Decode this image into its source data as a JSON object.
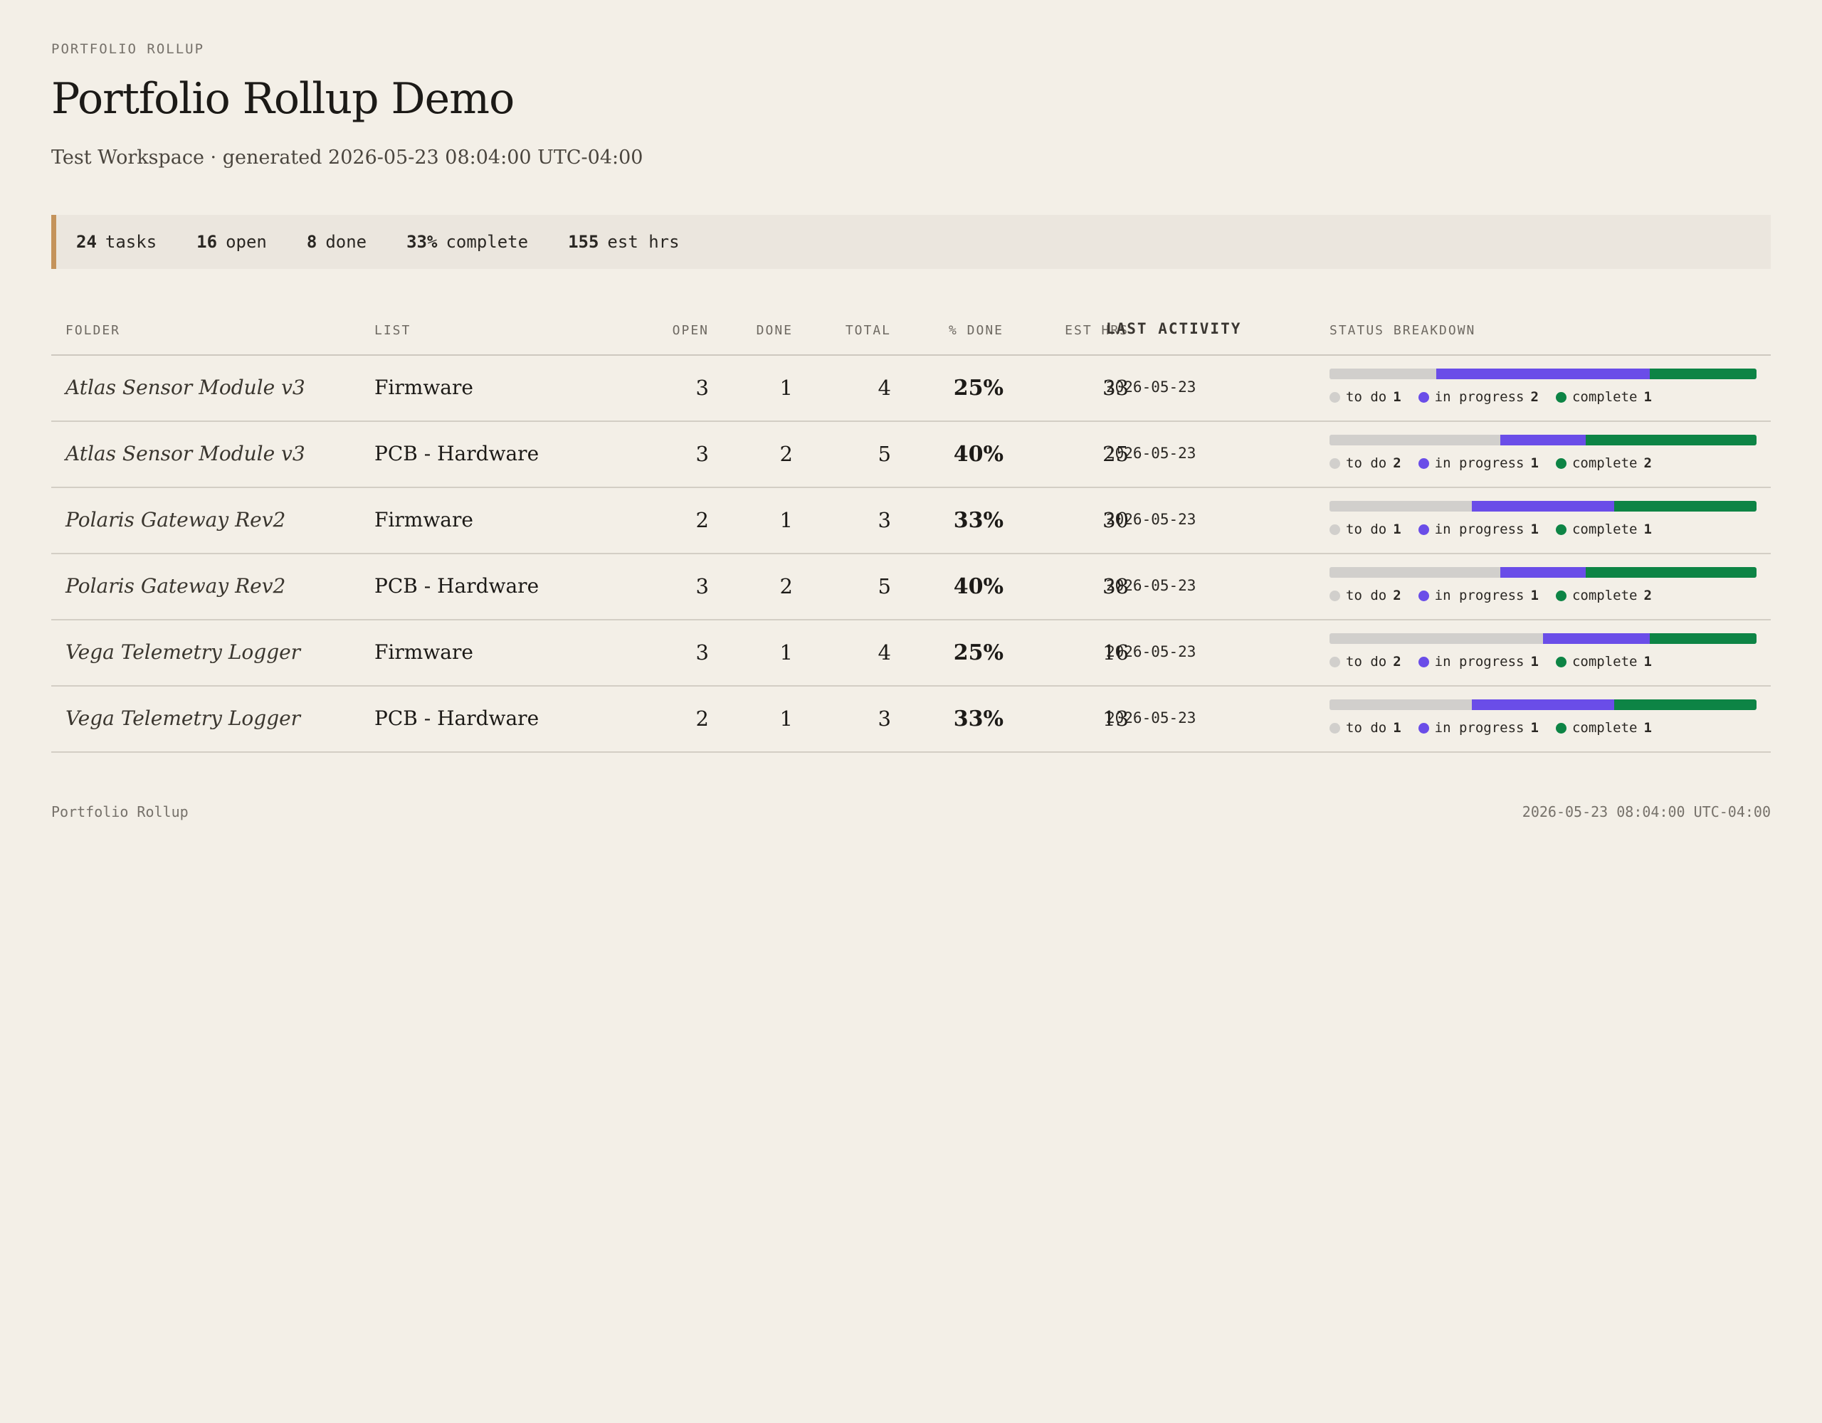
{
  "header": {
    "eyebrow": "PORTFOLIO ROLLUP",
    "title": "Portfolio Rollup Demo",
    "subtitle": "Test Workspace · generated 2026-05-23 08:04:00 UTC-04:00"
  },
  "summary": [
    {
      "value": "24",
      "label": "tasks"
    },
    {
      "value": "16",
      "label": "open"
    },
    {
      "value": "8",
      "label": "done"
    },
    {
      "value": "33%",
      "label": "complete"
    },
    {
      "value": "155",
      "label": "est hrs"
    }
  ],
  "columns": {
    "folder": "FOLDER",
    "list": "LIST",
    "open": "OPEN",
    "done": "DONE",
    "total": "TOTAL",
    "pct_done": "% DONE",
    "est_hrs": "EST HRS",
    "last_activity": "LAST ACTIVITY",
    "status_breakdown": "STATUS BREAKDOWN"
  },
  "legend_labels": {
    "todo": "to do",
    "in_progress": "in progress",
    "complete": "complete"
  },
  "colors": {
    "todo": "#d1cfcc",
    "in_progress": "#6a4de8",
    "complete": "#0d8445",
    "accent": "#c4935b"
  },
  "rows": [
    {
      "folder": "Atlas Sensor Module v3",
      "list": "Firmware",
      "open": "3",
      "done": "1",
      "total": "4",
      "pct_done": "25%",
      "est_hrs": "33",
      "last_activity": "2026-05-23",
      "todo": 1,
      "in_progress": 2,
      "complete": 1
    },
    {
      "folder": "Atlas Sensor Module v3",
      "list": "PCB - Hardware",
      "open": "3",
      "done": "2",
      "total": "5",
      "pct_done": "40%",
      "est_hrs": "25",
      "last_activity": "2026-05-23",
      "todo": 2,
      "in_progress": 1,
      "complete": 2
    },
    {
      "folder": "Polaris Gateway Rev2",
      "list": "Firmware",
      "open": "2",
      "done": "1",
      "total": "3",
      "pct_done": "33%",
      "est_hrs": "30",
      "last_activity": "2026-05-23",
      "todo": 1,
      "in_progress": 1,
      "complete": 1
    },
    {
      "folder": "Polaris Gateway Rev2",
      "list": "PCB - Hardware",
      "open": "3",
      "done": "2",
      "total": "5",
      "pct_done": "40%",
      "est_hrs": "38",
      "last_activity": "2026-05-23",
      "todo": 2,
      "in_progress": 1,
      "complete": 2
    },
    {
      "folder": "Vega Telemetry Logger",
      "list": "Firmware",
      "open": "3",
      "done": "1",
      "total": "4",
      "pct_done": "25%",
      "est_hrs": "16",
      "last_activity": "2026-05-23",
      "todo": 2,
      "in_progress": 1,
      "complete": 1
    },
    {
      "folder": "Vega Telemetry Logger",
      "list": "PCB - Hardware",
      "open": "2",
      "done": "1",
      "total": "3",
      "pct_done": "33%",
      "est_hrs": "13",
      "last_activity": "2026-05-23",
      "todo": 1,
      "in_progress": 1,
      "complete": 1
    }
  ],
  "footer": {
    "left": "Portfolio Rollup",
    "right": "2026-05-23 08:04:00 UTC-04:00"
  }
}
